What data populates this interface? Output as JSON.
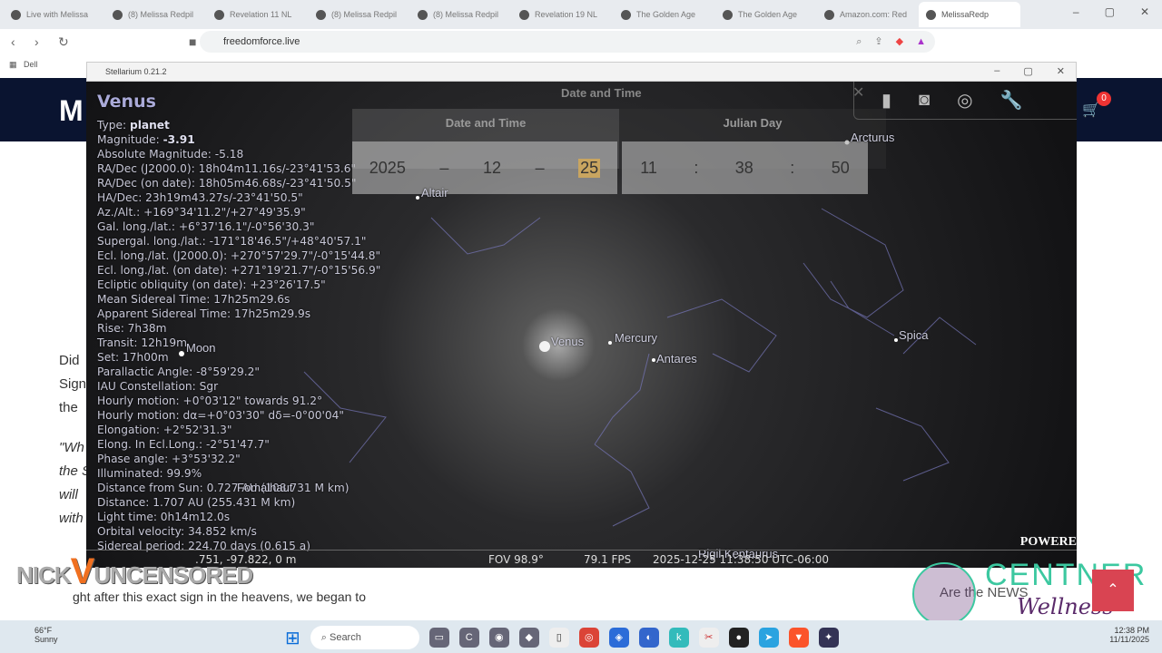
{
  "browser": {
    "tabs": [
      "Live with Melissa",
      "(8) Melissa Redpil",
      "Revelation 11 NL",
      "(8) Melissa Redpil",
      "(8) Melissa Redpil",
      "Revelation 19 NL",
      "The Golden Age",
      "The Golden Age",
      "Amazon.com: Red",
      "MelissaRedp"
    ],
    "url": "freedomforce.live",
    "bookmark": "Dell"
  },
  "site": {
    "header_letter": "M",
    "article_lines": [
      "Did",
      "Sign",
      "the"
    ],
    "quote_lines": [
      "\"Wh",
      "the S",
      "will",
      "with"
    ],
    "bottom_line": "ght after this exact sign in the heavens, we began to"
  },
  "stellarium": {
    "title": "Stellarium 0.21.2",
    "object": {
      "name": "Venus",
      "lines": [
        [
          "Type: ",
          "planet"
        ],
        [
          "Magnitude: ",
          "-3.91"
        ],
        [
          "Absolute Magnitude: -5.18",
          ""
        ],
        [
          "RA/Dec (J2000.0): 18h04m11.16s/-23°41'53.6\"",
          ""
        ],
        [
          "RA/Dec (on date): 18h05m46.68s/-23°41'50.5\"",
          ""
        ],
        [
          "HA/Dec: 23h19m43.27s/-23°41'50.5\"",
          ""
        ],
        [
          "Az./Alt.: +169°34'11.2\"/+27°49'35.9\"",
          ""
        ],
        [
          "Gal. long./lat.: +6°37'16.1\"/-0°56'30.3\"",
          ""
        ],
        [
          "Supergal. long./lat.: -171°18'46.5\"/+48°40'57.1\"",
          ""
        ],
        [
          "Ecl. long./lat. (J2000.0): +270°57'29.7\"/-0°15'44.8\"",
          ""
        ],
        [
          "Ecl. long./lat. (on date): +271°19'21.7\"/-0°15'56.9\"",
          ""
        ],
        [
          "Ecliptic obliquity (on date): +23°26'17.5\"",
          ""
        ],
        [
          "Mean Sidereal Time: 17h25m29.6s",
          ""
        ],
        [
          "Apparent Sidereal Time: 17h25m29.9s",
          ""
        ],
        [
          "Rise: 7h38m",
          ""
        ],
        [
          "Transit: 12h19m",
          ""
        ],
        [
          "Set: 17h00m",
          ""
        ],
        [
          "Parallactic Angle: -8°59'29.2\"",
          ""
        ],
        [
          "IAU Constellation: Sgr",
          ""
        ],
        [
          "Hourly motion: +0°03'12\" towards 91.2°",
          ""
        ],
        [
          "Hourly motion: dα=+0°03'30\" dδ=-0°00'04\"",
          ""
        ],
        [
          "Elongation: +2°52'31.3\"",
          ""
        ],
        [
          "Elong. In Ecl.Long.: -2°51'47.7\"",
          ""
        ],
        [
          "Phase angle: +3°53'32.2\"",
          ""
        ],
        [
          "Illuminated: 99.9%",
          ""
        ],
        [
          "Distance from Sun: 0.727 AU (108.731 M km)",
          ""
        ],
        [
          "Distance: 1.707 AU (255.431 M km)",
          ""
        ],
        [
          "Light time: 0h14m12.0s",
          ""
        ],
        [
          "Orbital velocity: 34.852 km/s",
          ""
        ],
        [
          "Sidereal period: 224.70 days (0.615 a)",
          ""
        ]
      ]
    },
    "datetime": {
      "window_title": "Date and Time",
      "tab_date": "Date and Time",
      "tab_julian": "Julian Day",
      "year": "2025",
      "month": "12",
      "day": "25",
      "hour": "11",
      "minute": "38",
      "second": "50",
      "dash": "–",
      "colon": ":"
    },
    "labels": {
      "arcturus": "Arcturus",
      "altair": "Altair",
      "moon": "Moon",
      "venus": "Venus",
      "mercury": "Mercury",
      "antares": "Antares",
      "spica": "Spica",
      "fomalhaut": "Fomalhaut",
      "rigil": "Rigil Kentaurus"
    },
    "status": {
      "location": ".751, -97.822, 0 m",
      "fov": "FOV 98.9°",
      "fps": "79.1 FPS",
      "datetime": "2025-12-25 11:38:50 UTC-06:00"
    }
  },
  "overlay": {
    "powered": "POWERE",
    "brand": "CENTNER",
    "brand_sub": "Wellness",
    "news": "Are the NEWS",
    "watermark": "NICK UNCENSORED",
    "cart_count": "0"
  },
  "taskbar": {
    "weather_temp": "66°F",
    "weather_desc": "Sunny",
    "search": "Search",
    "time": "12:38 PM",
    "date": "11/11/2025"
  }
}
